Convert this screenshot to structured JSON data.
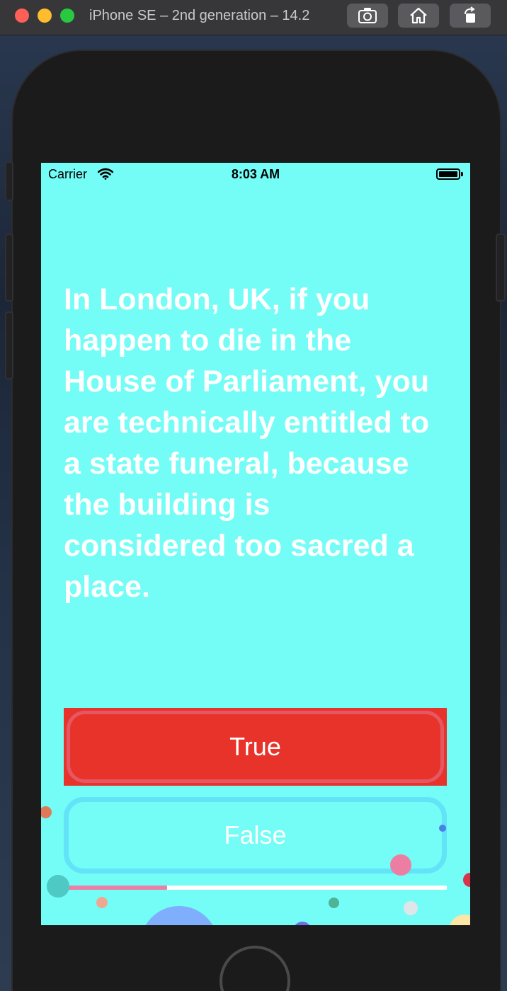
{
  "window": {
    "title": "iPhone SE – 2nd generation – 14.2"
  },
  "status_bar": {
    "carrier": "Carrier",
    "time": "8:03 AM"
  },
  "quiz": {
    "question": "In London, UK, if you happen to die in the House of Parliament, you are technically entitled to a state funeral, because the building is considered too sacred a place.",
    "true_label": "True",
    "false_label": "False",
    "progress_fraction": 0.27
  },
  "colors": {
    "screen_background": "#74fcf6",
    "true_button": "#e8332a",
    "false_button_border": "#62e3f8",
    "progress_fill": "#ea7fa8"
  }
}
